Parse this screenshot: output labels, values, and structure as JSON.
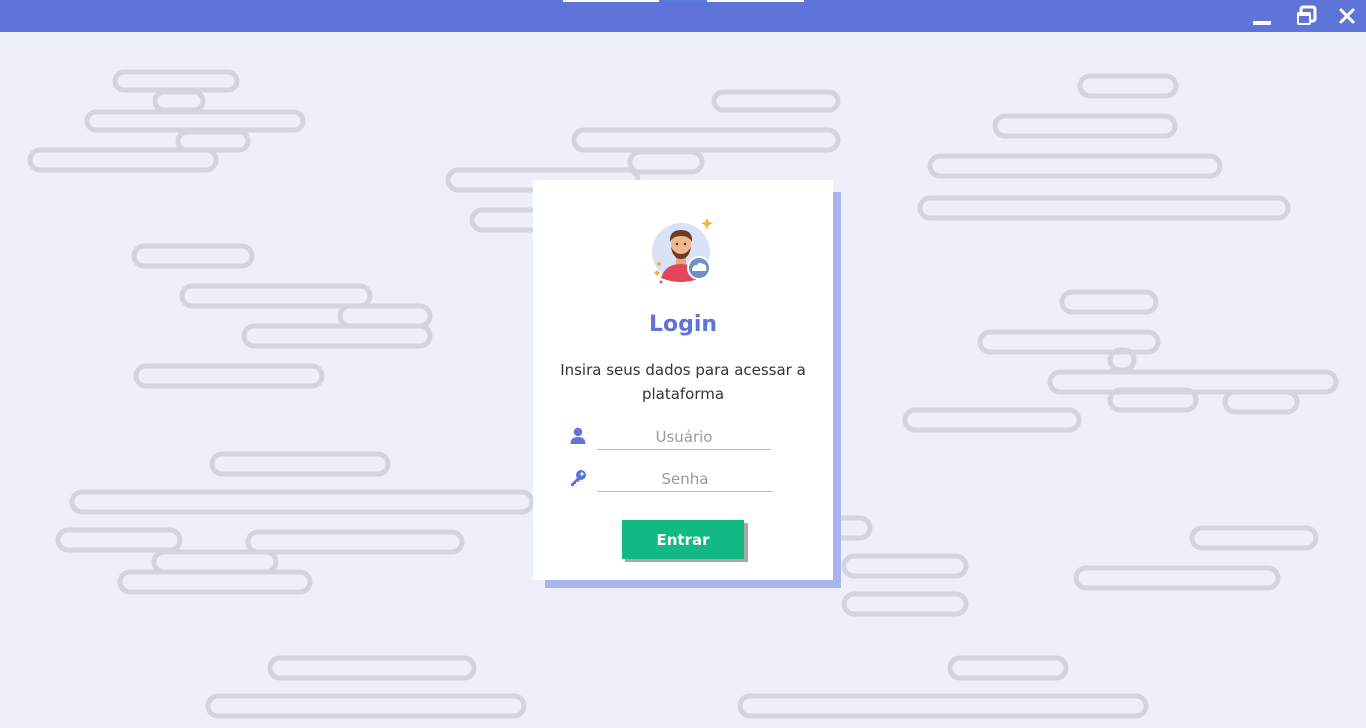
{
  "window": {
    "controls": {
      "minimize_icon": "minimize-icon",
      "maximize_icon": "restore-icon",
      "close_icon": "close-icon"
    }
  },
  "login": {
    "title": "Login",
    "subtitle": "Insira seus dados para acessar a plataforma",
    "username_placeholder": "Usuário",
    "password_placeholder": "Senha",
    "submit_label": "Entrar",
    "user_icon": "user-icon",
    "password_icon": "key-icon",
    "avatar_icon": "avatar-icon"
  },
  "colors": {
    "titlebar": "#5f74d8",
    "accent": "#5f74d8",
    "button": "#13b982",
    "background": "#edf0fb",
    "card_shadow": "#a9b5ee"
  }
}
